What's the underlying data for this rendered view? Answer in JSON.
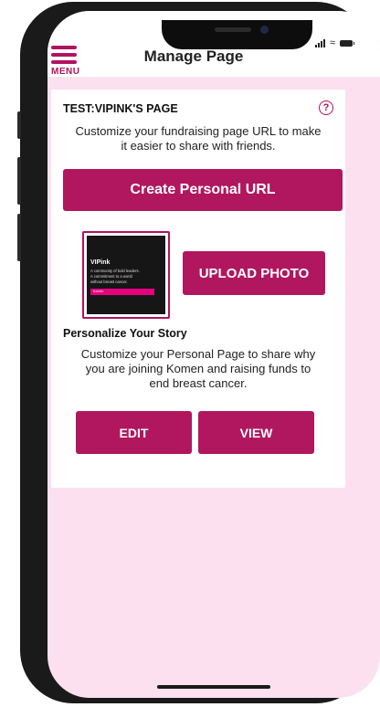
{
  "header": {
    "menu_label": "MENU",
    "title": "Manage Page"
  },
  "status_bar": {
    "icons": [
      "signal-icon",
      "wifi-icon",
      "battery-icon"
    ]
  },
  "card": {
    "page_name": "TEST:VIPINK'S PAGE",
    "help_icon": "?",
    "url_description": "Customize your fundraising page URL to make it easier to share with friends.",
    "create_url_label": "Create Personal URL",
    "photo": {
      "title": "VIPink",
      "lines": [
        "A community of bold leaders.",
        "A commitment to a world",
        "without breast cancer."
      ],
      "strip": "Komen"
    },
    "upload_label": "UPLOAD PHOTO",
    "story_title": "Personalize Your Story",
    "story_description": "Customize your Personal Page to share why you are joining Komen and raising funds to end breast cancer.",
    "edit_label": "EDIT",
    "view_label": "VIEW"
  },
  "colors": {
    "brand": "#b0175f",
    "background": "#fde0ef"
  }
}
